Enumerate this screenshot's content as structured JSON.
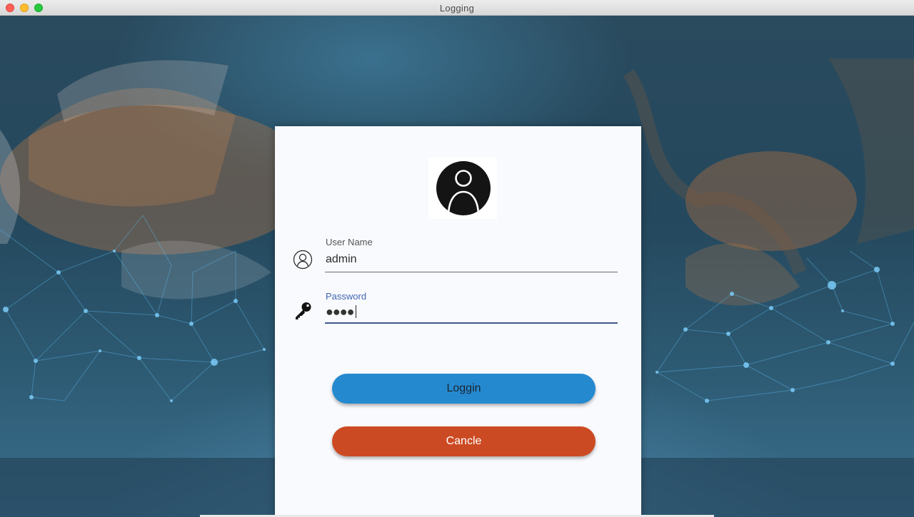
{
  "window": {
    "title": "Logging"
  },
  "form": {
    "username_label": "User Name",
    "username_value": "admin",
    "password_label": "Password",
    "password_masked": "●●●●"
  },
  "buttons": {
    "login_label": "Loggin",
    "cancel_label": "Cancle"
  },
  "colors": {
    "login_button": "#2589d0",
    "cancel_button": "#cc4a23",
    "password_focus": "#3f66b0"
  },
  "icons": {
    "avatar": "user-circle-icon",
    "username": "user-outline-icon",
    "password": "key-icon"
  }
}
